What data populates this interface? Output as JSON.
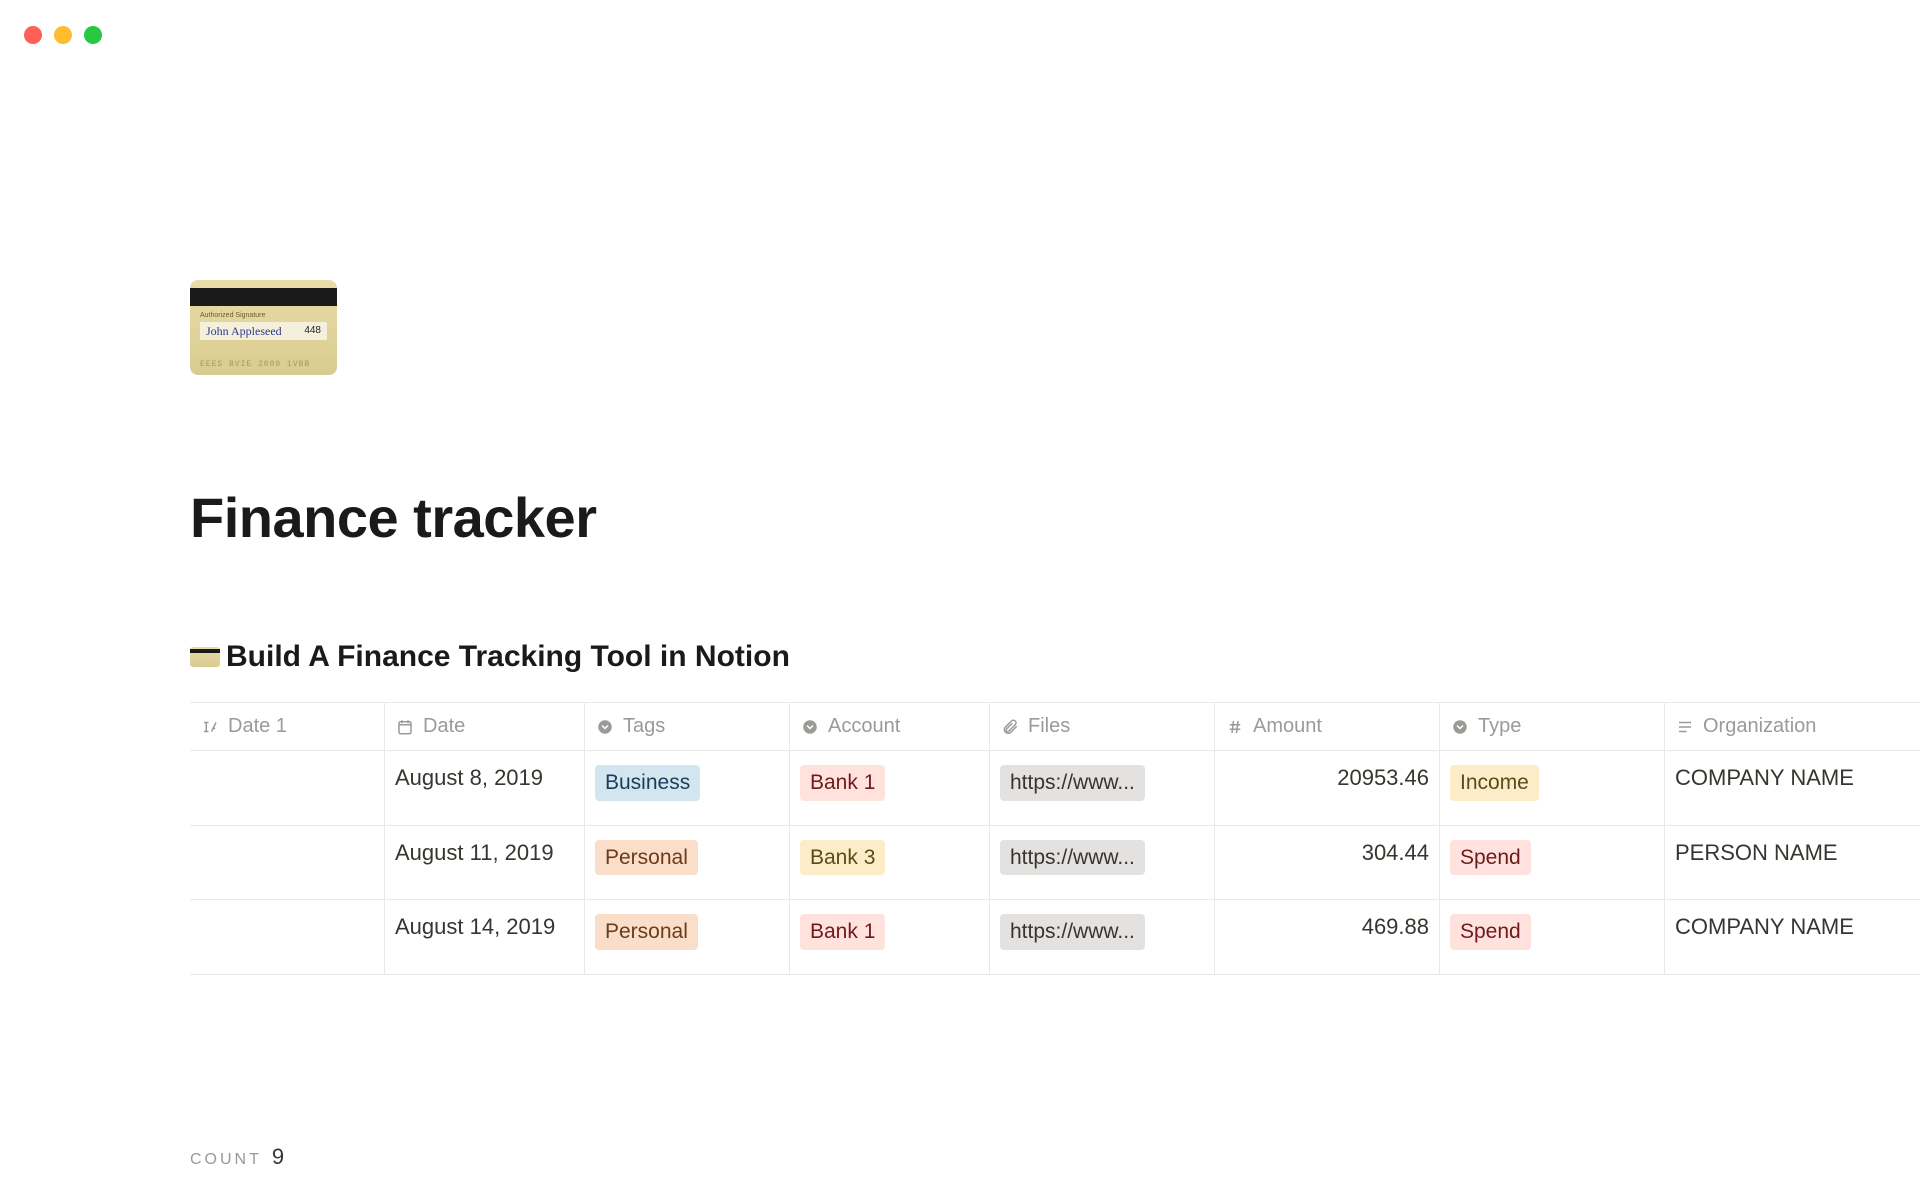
{
  "page": {
    "title": "Finance tracker",
    "section_title": "Build A Finance Tracking Tool in Notion",
    "card": {
      "sig_label": "Authorized Signature",
      "sig_name": "John Appleseed",
      "sig_num": "448",
      "emboss": "EEES  BVIE  2000  1VBB"
    }
  },
  "columns": {
    "date1": "Date 1",
    "date": "Date",
    "tags": "Tags",
    "account": "Account",
    "files": "Files",
    "amount": "Amount",
    "type": "Type",
    "organization": "Organization"
  },
  "tag_colors": {
    "Business": "blue",
    "Personal": "orange",
    "Bank 1": "red",
    "Bank 3": "yellow",
    "Income": "yellow",
    "Spend": "red"
  },
  "rows": [
    {
      "date": "August 8, 2019",
      "tags": "Business",
      "account": "Bank 1",
      "files": "https://www...",
      "amount": "20953.46",
      "type": "Income",
      "organization": "COMPANY NAME"
    },
    {
      "date": "August 11, 2019",
      "tags": "Personal",
      "account": "Bank 3",
      "files": "https://www...",
      "amount": "304.44",
      "type": "Spend",
      "organization": "PERSON NAME"
    },
    {
      "date": "August 14, 2019",
      "tags": "Personal",
      "account": "Bank 1",
      "files": "https://www...",
      "amount": "469.88",
      "type": "Spend",
      "organization": "COMPANY NAME"
    }
  ],
  "footer": {
    "label": "COUNT",
    "value": "9"
  }
}
